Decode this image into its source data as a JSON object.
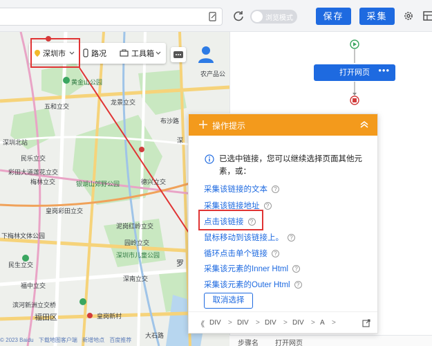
{
  "toolbar": {
    "browse_mode_label": "浏览模式",
    "save_label": "保存",
    "collect_label": "采集"
  },
  "map": {
    "control": {
      "city": "深圳市",
      "route": "路况",
      "tools": "工具箱"
    },
    "labels": [
      {
        "id": "label-yunan",
        "text": "农产品公"
      },
      {
        "id": "label-huangjin",
        "text": "黄金山公园"
      },
      {
        "id": "label-wuhe",
        "text": "五和立交"
      },
      {
        "id": "label-longjing",
        "text": "龙景立交"
      },
      {
        "id": "label-buzhai",
        "text": "布沙路"
      },
      {
        "id": "label-shenzhenbei",
        "text": "深圳北站"
      },
      {
        "id": "label-minle",
        "text": "民乐立交"
      },
      {
        "id": "label-dadaoqiao",
        "text": "彩田大道莲花立交"
      },
      {
        "id": "label-meilin",
        "text": "梅林立交"
      },
      {
        "id": "label-yinhu",
        "text": "银湖山郊野公园"
      },
      {
        "id": "label-deshi",
        "text": "德兴立交"
      },
      {
        "id": "label-huanggang",
        "text": "皇岗彩田立交"
      },
      {
        "id": "label-nifeng",
        "text": "泥岗红岭立交"
      },
      {
        "id": "label-xiamei",
        "text": "下梅林文体公园"
      },
      {
        "id": "label-yuanling",
        "text": "园岭立交"
      },
      {
        "id": "label-ertong",
        "text": "深圳市儿童公园"
      },
      {
        "id": "label-minsheng",
        "text": "民生立交"
      },
      {
        "id": "label-fuzhong",
        "text": "福中立交"
      },
      {
        "id": "label-shennan",
        "text": "深南立交"
      },
      {
        "id": "label-binhe",
        "text": "滨河新洲立交桥"
      },
      {
        "id": "label-futian",
        "text": "福田区"
      },
      {
        "id": "label-huangxin",
        "text": "皇岗新村"
      },
      {
        "id": "label-dashi",
        "text": "大石路"
      },
      {
        "id": "label-luo",
        "text": "罗"
      },
      {
        "id": "label-side",
        "text": "深"
      }
    ],
    "footer": [
      "© 2023 Baidu",
      "下载地图客户端",
      "新增地点",
      "百度推荐"
    ]
  },
  "workflow": {
    "node_label": "打开网页",
    "node_more": "•••",
    "bottom_key": "步骤名",
    "bottom_value": "打开网页"
  },
  "tip_panel": {
    "title": "操作提示",
    "message": "已选中链接，您可以继续选择页面其他元素，或：",
    "actions": [
      "采集该链接的文本",
      "采集该链接地址",
      "点击该链接",
      "鼠标移动到该链接上。",
      "循环点击单个链接",
      "采集该元素的Inner Html",
      "采集该元素的Outer Html"
    ],
    "cancel_label": "取消选择",
    "breadcrumb": [
      "DIV",
      "DIV",
      "DIV",
      "DIV",
      "A"
    ],
    "crumb_start": "《",
    "crumb_sep": ">"
  },
  "colors": {
    "accent": "#1e6ae0",
    "tip_header": "#f39a1c",
    "highlight": "#e03434",
    "park": "#c9e8c1"
  }
}
